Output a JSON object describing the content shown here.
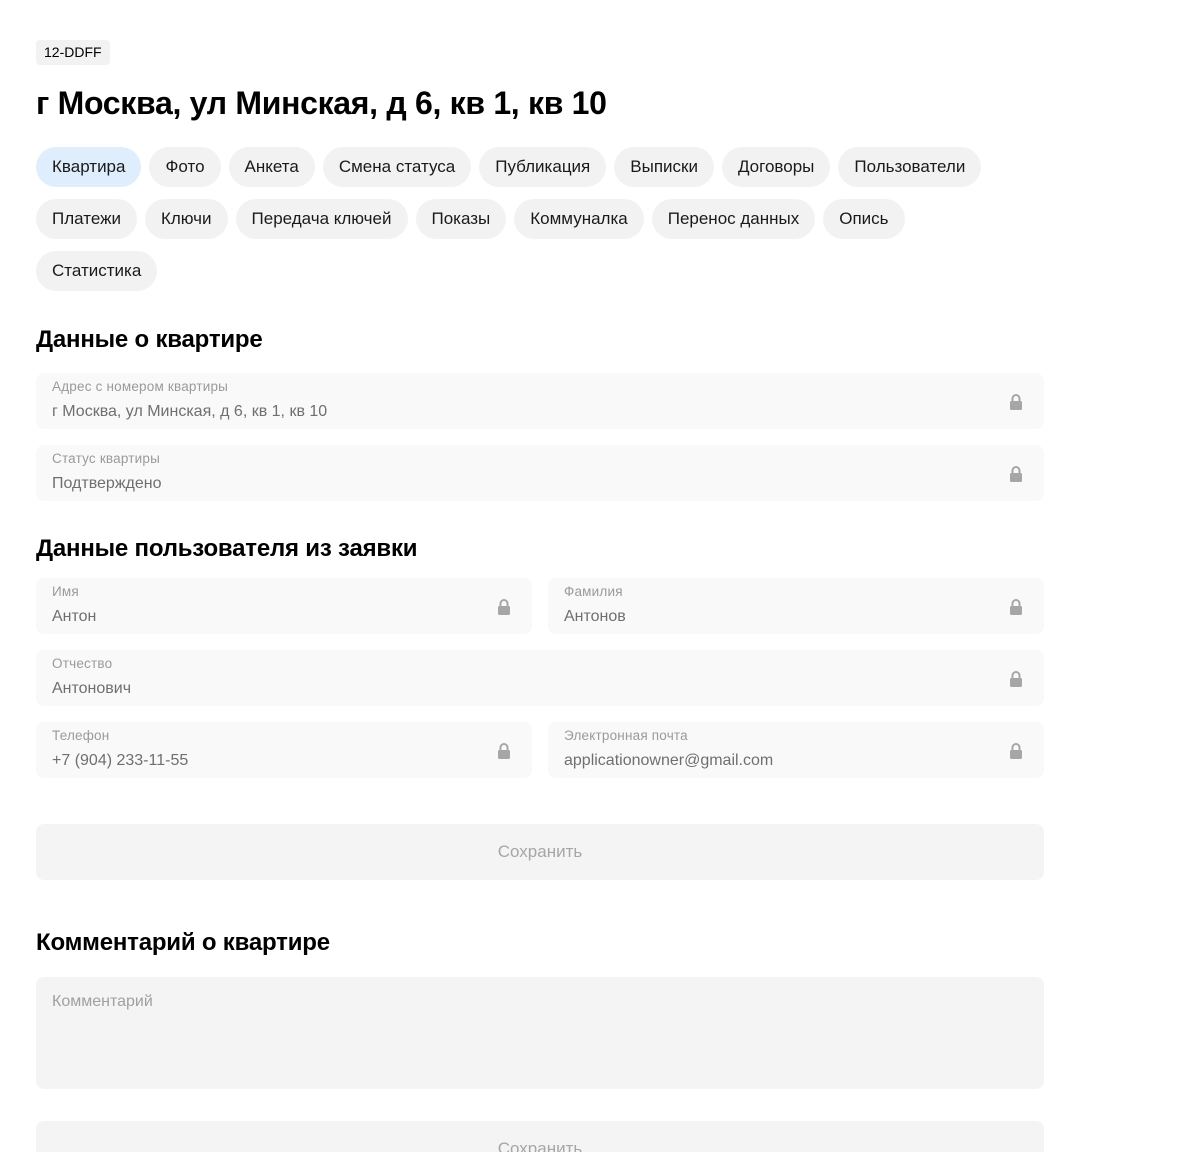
{
  "header": {
    "badge": "12-DDFF",
    "title": "г Москва, ул Минская, д 6, кв 1, кв 10"
  },
  "tabs": [
    {
      "label": "Квартира",
      "active": true
    },
    {
      "label": "Фото",
      "active": false
    },
    {
      "label": "Анкета",
      "active": false
    },
    {
      "label": "Смена статуса",
      "active": false
    },
    {
      "label": "Публикация",
      "active": false
    },
    {
      "label": "Выписки",
      "active": false
    },
    {
      "label": "Договоры",
      "active": false
    },
    {
      "label": "Пользователи",
      "active": false
    },
    {
      "label": "Платежи",
      "active": false
    },
    {
      "label": "Ключи",
      "active": false
    },
    {
      "label": "Передача ключей",
      "active": false
    },
    {
      "label": "Показы",
      "active": false
    },
    {
      "label": "Коммуналка",
      "active": false
    },
    {
      "label": "Перенос данных",
      "active": false
    },
    {
      "label": "Опись",
      "active": false
    },
    {
      "label": "Статистика",
      "active": false
    }
  ],
  "flat_section": {
    "title": "Данные о квартире",
    "address": {
      "label": "Адрес с номером квартиры",
      "value": "г Москва, ул Минская, д 6, кв 1, кв 10"
    },
    "status": {
      "label": "Статус квартиры",
      "value": "Подтверждено"
    }
  },
  "user_section": {
    "title": "Данные пользователя из заявки",
    "first_name": {
      "label": "Имя",
      "value": "Антон"
    },
    "last_name": {
      "label": "Фамилия",
      "value": "Антонов"
    },
    "patronymic": {
      "label": "Отчество",
      "value": "Антонович"
    },
    "phone": {
      "label": "Телефон",
      "value": "+7 (904) 233-11-55"
    },
    "email": {
      "label": "Электронная почта",
      "value": "applicationowner@gmail.com"
    },
    "save_label": "Сохранить"
  },
  "comment_section": {
    "title": "Комментарий о квартире",
    "placeholder": "Комментарий",
    "save_label": "Сохранить"
  },
  "colors": {
    "active_tab": "#dfeefd",
    "tab": "#f2f2f2",
    "field_bg": "#f9f9f9",
    "lock_icon": "#a6a6a6"
  },
  "icons": {
    "field_lock": "lock-icon"
  }
}
